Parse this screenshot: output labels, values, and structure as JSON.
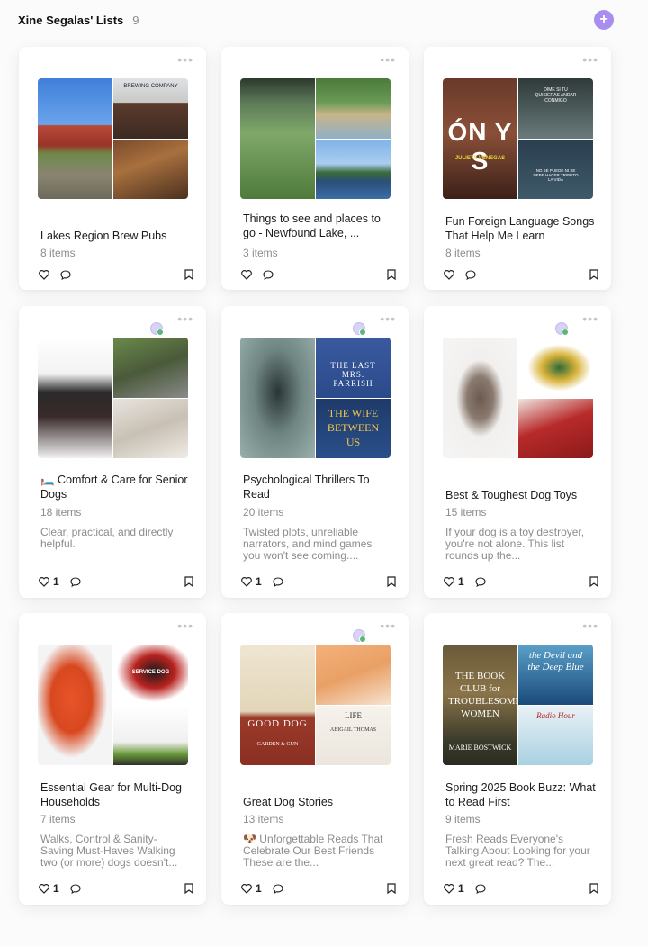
{
  "header": {
    "title": "Xine Segalas' Lists",
    "count": "9",
    "add_label": "+"
  },
  "cards": [
    {
      "title": "Lakes Region Brew Pubs",
      "count": "8 items",
      "desc": "",
      "likes": "",
      "images": {
        "brewery_sign": "BREWING COMPANY"
      }
    },
    {
      "title": "Things to see and places to go - Newfound Lake, ...",
      "count": "3 items",
      "desc": "",
      "likes": ""
    },
    {
      "title": "Fun Foreign Language Songs That Help Me Learn",
      "count": "8 items",
      "desc": "",
      "likes": "",
      "images": {
        "album_text": "ÓN Y S",
        "album_artist": "JULIETA VENEGAS",
        "top_text": "DIME SI TU QUISIERAS ANDAR CONMIGO",
        "bottom_text": "NO SE PUEDE NI SE DEBE HACER TRIBUTO LA VIDA"
      }
    },
    {
      "title": "🛏️ Comfort & Care for Senior Dogs",
      "count": "18 items",
      "desc": "Clear, practical, and directly helpful.",
      "likes": "1"
    },
    {
      "title": "Psychological Thrillers To Read",
      "count": "20 items",
      "desc": "Twisted plots, unreliable narrators, and mind games you won't see coming....",
      "likes": "1",
      "images": {
        "book1_title": "THE LAST MRS. PARRISH",
        "book2_title": "THE WIFE BETWEEN US"
      }
    },
    {
      "title": "Best & Toughest Dog Toys",
      "count": "15 items",
      "desc": "If your dog is a toy destroyer, you're not alone. This list rounds up the...",
      "likes": "1"
    },
    {
      "title": "Essential Gear for Multi-Dog Households",
      "count": "7 items",
      "desc": "Walks, Control & Sanity-Saving Must-Haves Walking two (or more) dogs doesn't...",
      "likes": "1",
      "images": {
        "vest_text": "SERVICE DOG"
      }
    },
    {
      "title": "Great Dog Stories",
      "count": "13 items",
      "desc": "🐶 Unforgettable Reads That Celebrate Our Best Friends These are the...",
      "likes": "1",
      "images": {
        "book1_title": "GOOD DOG",
        "book1_sub": "GARDEN & GUN",
        "book2_title": "LIFE",
        "book2_author": "ABIGAIL THOMAS"
      }
    },
    {
      "title": "Spring 2025 Book Buzz: What to Read First",
      "count": "9 items",
      "desc": "Fresh Reads Everyone's Talking About Looking for your next great read? The...",
      "likes": "1",
      "images": {
        "book1_title": "THE BOOK CLUB for TROUBLESOME WOMEN",
        "book1_author": "MARIE BOSTWICK",
        "book2_title": "the Devil and the Deep Blue",
        "book3_title": "Radio Hour"
      }
    }
  ],
  "colors": {
    "accent": "#a98ef0",
    "collab_dot": "#57b87a"
  }
}
